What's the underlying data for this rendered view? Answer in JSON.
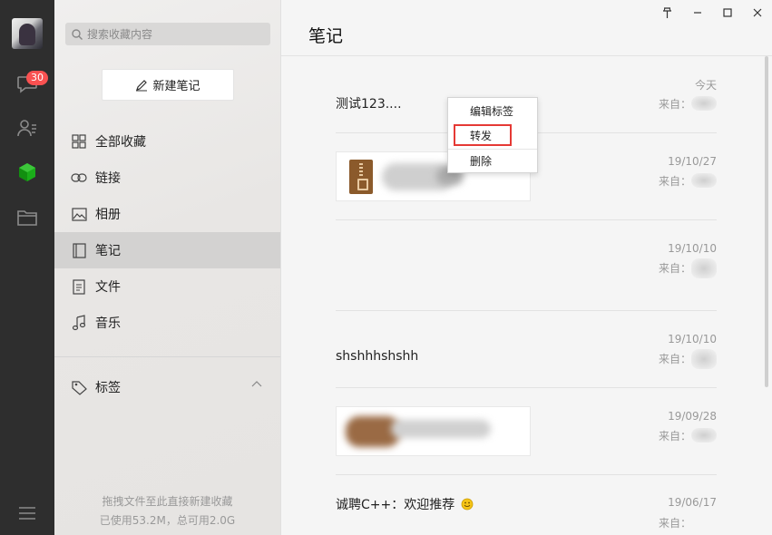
{
  "rail": {
    "unread_badge": "30"
  },
  "sidebar": {
    "search_placeholder": "搜索收藏内容",
    "new_note_label": "新建笔记",
    "nav_items": [
      {
        "label": "全部收藏",
        "icon": "grid-icon"
      },
      {
        "label": "链接",
        "icon": "link-icon"
      },
      {
        "label": "相册",
        "icon": "image-icon"
      },
      {
        "label": "笔记",
        "icon": "notebook-icon",
        "active": true
      },
      {
        "label": "文件",
        "icon": "file-icon"
      },
      {
        "label": "音乐",
        "icon": "music-icon"
      }
    ],
    "tags_label": "标签",
    "footer_hint": "拖拽文件至此直接新建收藏",
    "footer_storage": "已使用53.2M，总可用2.0G"
  },
  "main": {
    "title": "笔记",
    "window_controls": [
      "pin",
      "minimize",
      "maximize",
      "close"
    ],
    "notes": [
      {
        "title": "测试123....",
        "date": "今天",
        "from": "来自："
      },
      {
        "title": "",
        "date": "19/10/27",
        "from": "来自：",
        "attachment": "zip-file"
      },
      {
        "title": "",
        "date": "19/10/10",
        "from": "来自："
      },
      {
        "title": "shshhhshshh",
        "date": "19/10/10",
        "from": "来自："
      },
      {
        "title": "",
        "date": "19/09/28",
        "from": "来自：",
        "attachment": "image"
      },
      {
        "title": "诚聘C++：欢迎推荐",
        "date": "19/06/17",
        "from": "来自：",
        "emoji": "smile"
      }
    ]
  },
  "context_menu": {
    "items": [
      "编辑标签",
      "转发",
      "删除"
    ],
    "highlighted": "转发",
    "highlight_color": "#e53935"
  },
  "colors": {
    "rail_bg": "#2e2e2e",
    "badge": "#fa5151",
    "accent_green": "#1aad19"
  }
}
